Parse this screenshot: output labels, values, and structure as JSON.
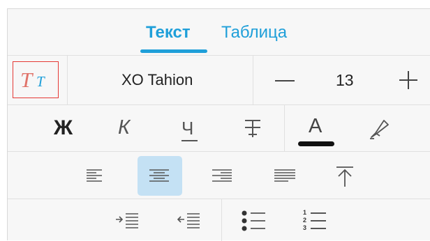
{
  "tabs": [
    {
      "label": "Текст",
      "active": true
    },
    {
      "label": "Таблица",
      "active": false
    }
  ],
  "font": {
    "name": "XO Tahion",
    "size": "13"
  },
  "icons": {
    "text_styles": "text-styles-icon",
    "decrease": "minus-icon",
    "increase": "plus-icon",
    "bold": "bold-icon",
    "italic": "italic-icon",
    "underline": "underline-icon",
    "strikethrough": "strikethrough-icon",
    "font_color": "font-color-icon",
    "highlight": "highlighter-icon",
    "align_left": "align-left-icon",
    "align_center": "align-center-icon",
    "align_right": "align-right-icon",
    "justify": "justify-icon",
    "valign_top": "vertical-align-top-icon",
    "indent": "indent-icon",
    "outdent": "outdent-icon",
    "bulleted_list": "bulleted-list-icon",
    "numbered_list": "numbered-list-icon"
  },
  "glyphs": {
    "text_styles_big": "T",
    "text_styles_small": "T",
    "bold": "Ж",
    "italic": "К",
    "underline": "Ч",
    "font_color": "A",
    "numbered": [
      "1",
      "2",
      "3"
    ]
  },
  "colors": {
    "accent": "#1f9fd9",
    "selected_background": "#c4e1f4",
    "style_border": "#e53935",
    "style_big": "#e0736a",
    "font_color_bar": "#111111"
  },
  "state": {
    "selected_alignment": "center"
  }
}
